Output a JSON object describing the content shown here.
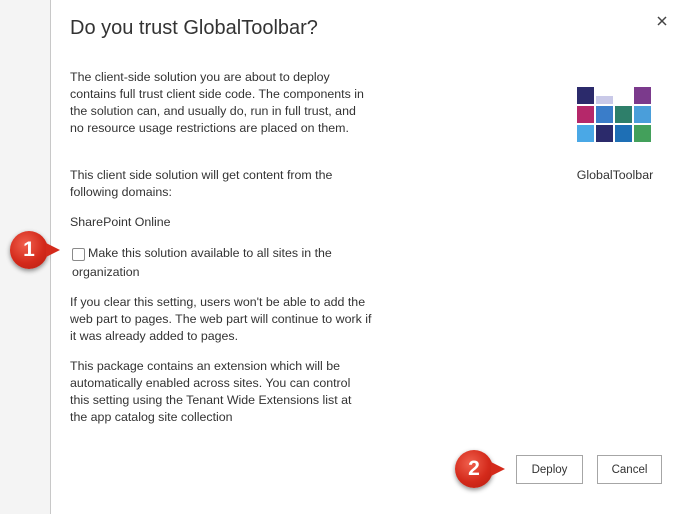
{
  "dialog": {
    "title": "Do you trust GlobalToolbar?",
    "close_icon": "close-icon",
    "paragraph_trust": "The client-side solution you are about to deploy contains full trust client side code. The components in the solution can, and usually do, run in full trust, and no resource usage restrictions are placed on them.",
    "paragraph_domains": "This client side solution will get content from the following domains:",
    "domain": "SharePoint Online",
    "checkbox_label": "Make this solution available to all sites in the organization",
    "checkbox_checked": false,
    "paragraph_clear_setting": "If you clear this setting, users won't be able to add the web part to pages. The web part will continue to work if it was already added to pages.",
    "paragraph_extension": "This package contains an extension which will be automatically enabled across sites. You can control this setting using the Tenant Wide Extensions list at the app catalog site collection"
  },
  "app": {
    "name": "GlobalToolbar",
    "logo_colors": [
      "#2b2a6b",
      "#b5286a",
      "#3a7dc9",
      "#43a05b",
      "#1e8fc9",
      "#5a2d7a",
      "#c9c9e8",
      "#2e7f6a",
      "#4a9eda",
      "#7b3a8c"
    ]
  },
  "actions": {
    "deploy_label": "Deploy",
    "cancel_label": "Cancel"
  },
  "annotations": {
    "marker_1": "1",
    "marker_2": "2",
    "color": "#d42a1b"
  }
}
